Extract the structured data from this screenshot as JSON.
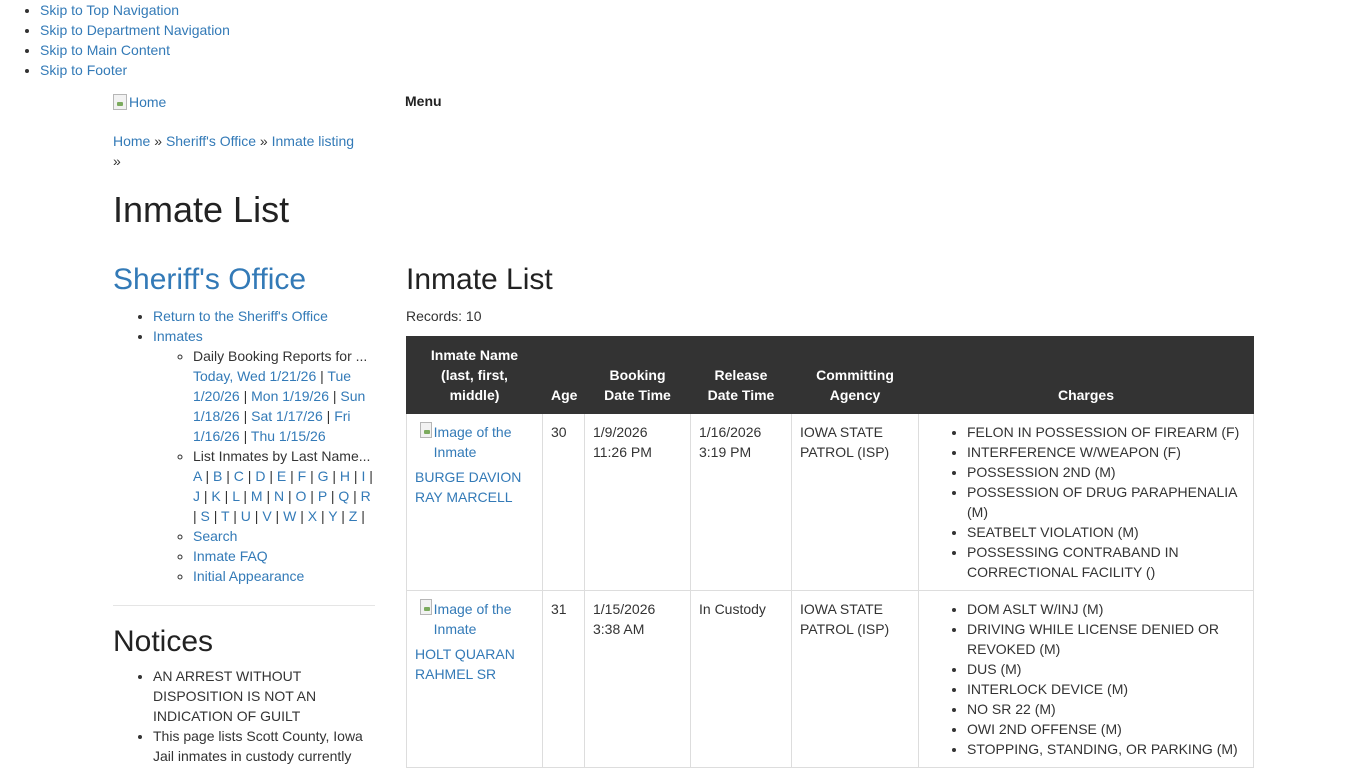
{
  "skip_links": [
    "Skip to Top Navigation",
    "Skip to Department Navigation",
    "Skip to Main Content",
    "Skip to Footer"
  ],
  "header": {
    "logo_alt": "Home",
    "menu_label": "Menu"
  },
  "breadcrumb": {
    "items": [
      "Home",
      "Sheriff's Office",
      "Inmate listing"
    ],
    "separator": "»"
  },
  "page_title": "Inmate List",
  "sidebar": {
    "title": "Sheriff's Office",
    "return_link": "Return to the Sheriff's Office",
    "inmates_link": "Inmates",
    "daily_booking_label": "Daily Booking Reports for ...",
    "day_links": [
      "Today, Wed 1/21/26",
      "Tue 1/20/26",
      "Mon 1/19/26",
      "Sun 1/18/26",
      "Sat 1/17/26",
      "Fri 1/16/26",
      "Thu 1/15/26"
    ],
    "list_by_last_name_label": "List Inmates by Last Name...",
    "letters": [
      "A",
      "B",
      "C",
      "D",
      "E",
      "F",
      "G",
      "H",
      "I",
      "J",
      "K",
      "L",
      "M",
      "N",
      "O",
      "P",
      "Q",
      "R",
      "S",
      "T",
      "U",
      "V",
      "W",
      "X",
      "Y",
      "Z"
    ],
    "search_link": "Search",
    "faq_link": "Inmate FAQ",
    "initial_appearance_link": "Initial Appearance"
  },
  "notices": {
    "title": "Notices",
    "items": [
      "AN ARREST WITHOUT DISPOSITION IS NOT AN INDICATION OF GUILT",
      "This page lists Scott County, Iowa Jail inmates in custody currently"
    ]
  },
  "main": {
    "title": "Inmate List",
    "records": "Records: 10",
    "columns": [
      "Inmate Name (last, first, middle)",
      "Age",
      "Booking Date Time",
      "Release Date Time",
      "Committing Agency",
      "Charges"
    ],
    "image_alt": "Image of the Inmate",
    "rows": [
      {
        "name": "BURGE DAVION RAY MARCELL",
        "age": "30",
        "booking": "1/9/2026 11:26 PM",
        "release": "1/16/2026 3:19 PM",
        "agency": "IOWA STATE PATROL (ISP)",
        "charges": [
          "FELON IN POSSESSION OF FIREARM (F)",
          "INTERFERENCE W/WEAPON (F)",
          "POSSESSION 2ND (M)",
          "POSSESSION OF DRUG PARAPHENALIA (M)",
          "SEATBELT VIOLATION (M)",
          "POSSESSING CONTRABAND IN CORRECTIONAL FACILITY ()"
        ]
      },
      {
        "name": "HOLT QUARAN RAHMEL SR",
        "age": "31",
        "booking": "1/15/2026 3:38 AM",
        "release": "In Custody",
        "agency": "IOWA STATE PATROL (ISP)",
        "charges": [
          "DOM ASLT W/INJ (M)",
          "DRIVING WHILE LICENSE DENIED OR REVOKED (M)",
          "DUS (M)",
          "INTERLOCK DEVICE (M)",
          "NO SR 22 (M)",
          "OWI 2ND OFFENSE (M)",
          "STOPPING, STANDING, OR PARKING (M)"
        ]
      }
    ]
  }
}
